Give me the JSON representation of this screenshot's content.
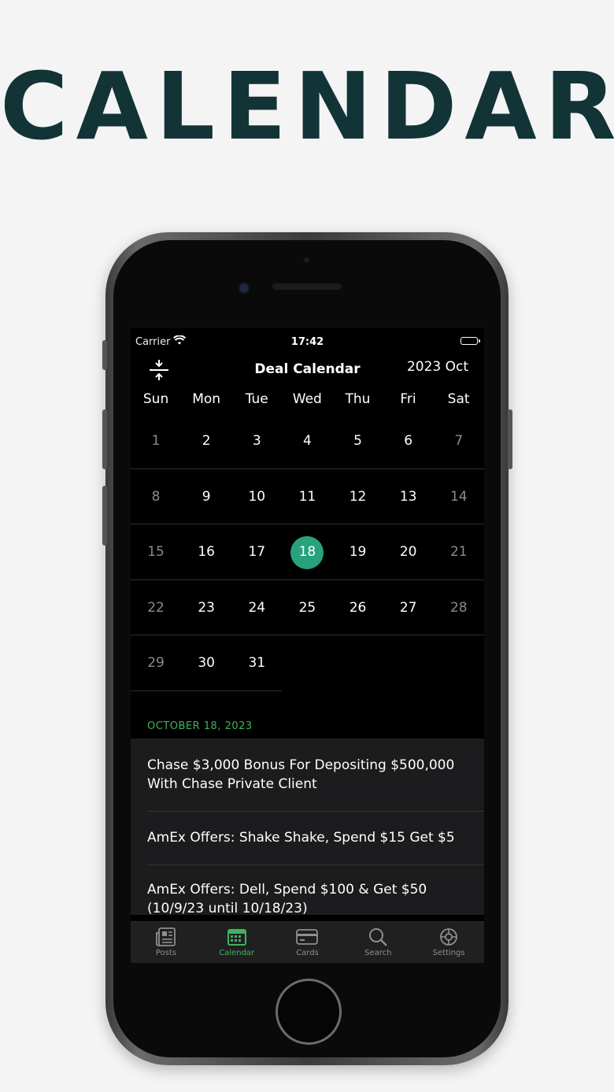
{
  "hero": {
    "title": "CALENDAR"
  },
  "status": {
    "carrier": "Carrier",
    "time": "17:42"
  },
  "nav": {
    "title": "Deal Calendar",
    "month": "2023 Oct"
  },
  "weekdays": [
    "Sun",
    "Mon",
    "Tue",
    "Wed",
    "Thu",
    "Fri",
    "Sat"
  ],
  "weeks": [
    [
      "1",
      "2",
      "3",
      "4",
      "5",
      "6",
      "7"
    ],
    [
      "8",
      "9",
      "10",
      "11",
      "12",
      "13",
      "14"
    ],
    [
      "15",
      "16",
      "17",
      "18",
      "19",
      "20",
      "21"
    ],
    [
      "22",
      "23",
      "24",
      "25",
      "26",
      "27",
      "28"
    ],
    [
      "29",
      "30",
      "31",
      "",
      "",
      "",
      ""
    ]
  ],
  "selected_day": "18",
  "section": {
    "date": "OCTOBER 18, 2023"
  },
  "deals": [
    "Chase $3,000 Bonus For Depositing $500,000 With Chase Private Client",
    "AmEx Offers: Shake Shake, Spend $15 Get $5",
    "AmEx Offers: Dell, Spend $100 & Get $50 (10/9/23 until 10/18/23)"
  ],
  "tabs": [
    {
      "label": "Posts",
      "icon": "newspaper-icon"
    },
    {
      "label": "Calendar",
      "icon": "calendar-icon"
    },
    {
      "label": "Cards",
      "icon": "credit-card-icon"
    },
    {
      "label": "Search",
      "icon": "search-icon"
    },
    {
      "label": "Settings",
      "icon": "gear-icon"
    }
  ],
  "colors": {
    "accent": "#3eb35f",
    "selected": "#27a27d",
    "hero": "#123437"
  }
}
